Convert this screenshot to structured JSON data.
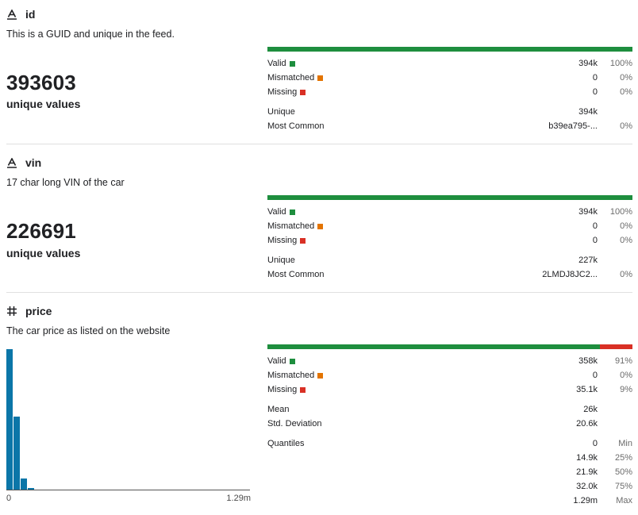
{
  "legend": {
    "valid": "Valid",
    "mismatched": "Mismatched",
    "missing": "Missing",
    "colors": {
      "valid": "#1e8e3e",
      "mismatched": "#e37400",
      "missing": "#d93025",
      "histogram": "#0b76a8"
    }
  },
  "columns": [
    {
      "icon": "string-type-icon",
      "name": "id",
      "description": "This is a GUID and unique in the feed.",
      "unique_count": "393603",
      "unique_label": "unique values",
      "bar": {
        "valid_fraction": 1.0,
        "missing_fraction": 0.0
      },
      "valid": {
        "value": "394k",
        "pct": "100%"
      },
      "mismatched": {
        "value": "0",
        "pct": "0%"
      },
      "missing": {
        "value": "0",
        "pct": "0%"
      },
      "unique": {
        "label": "Unique",
        "value": "394k"
      },
      "most_common": {
        "label": "Most Common",
        "value": "b39ea795-...",
        "pct": "0%"
      }
    },
    {
      "icon": "string-type-icon",
      "name": "vin",
      "description": "17 char long VIN of the car",
      "unique_count": "226691",
      "unique_label": "unique values",
      "bar": {
        "valid_fraction": 1.0,
        "missing_fraction": 0.0
      },
      "valid": {
        "value": "394k",
        "pct": "100%"
      },
      "mismatched": {
        "value": "0",
        "pct": "0%"
      },
      "missing": {
        "value": "0",
        "pct": "0%"
      },
      "unique": {
        "label": "Unique",
        "value": "227k"
      },
      "most_common": {
        "label": "Most Common",
        "value": "2LMDJ8JC2...",
        "pct": "0%"
      }
    },
    {
      "icon": "numeric-type-icon",
      "name": "price",
      "description": "The car price as listed on the website",
      "bar": {
        "valid_fraction": 0.91,
        "missing_fraction": 0.09
      },
      "valid": {
        "value": "358k",
        "pct": "91%"
      },
      "mismatched": {
        "value": "0",
        "pct": "0%"
      },
      "missing": {
        "value": "35.1k",
        "pct": "9%"
      },
      "mean": {
        "label": "Mean",
        "value": "26k"
      },
      "std": {
        "label": "Std. Deviation",
        "value": "20.6k"
      },
      "quantiles": {
        "label": "Quantiles",
        "rows": [
          {
            "value": "0",
            "name": "Min"
          },
          {
            "value": "14.9k",
            "name": "25%"
          },
          {
            "value": "21.9k",
            "name": "50%"
          },
          {
            "value": "32.0k",
            "name": "75%"
          },
          {
            "value": "1.29m",
            "name": "Max"
          }
        ]
      },
      "histogram": {
        "x_min_label": "0",
        "x_max_label": "1.29m",
        "relative_heights": [
          1.0,
          0.52,
          0.08,
          0.01,
          0,
          0,
          0,
          0,
          0,
          0,
          0,
          0,
          0,
          0,
          0,
          0,
          0,
          0,
          0,
          0,
          0,
          0,
          0,
          0,
          0,
          0,
          0,
          0,
          0,
          0,
          0,
          0,
          0,
          0
        ]
      }
    }
  ]
}
